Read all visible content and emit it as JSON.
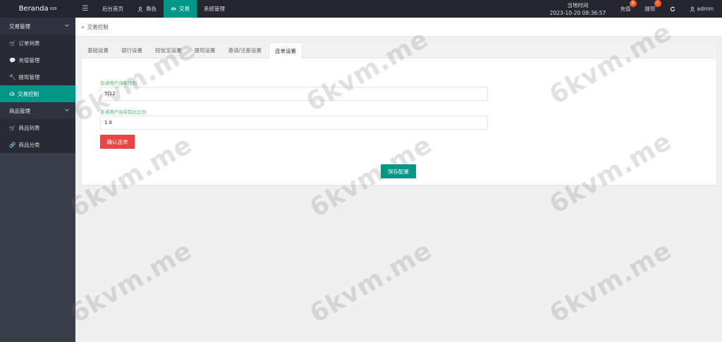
{
  "topbar": {
    "brand": "Beranda",
    "brand_version": "V20",
    "nav": [
      {
        "label": "后台首页",
        "icon": "home-icon"
      },
      {
        "label": "角色",
        "icon": "user-icon"
      },
      {
        "label": "交易",
        "icon": "scale-icon"
      },
      {
        "label": "系统管理",
        "icon": ""
      }
    ],
    "time_label": "当地时间",
    "time_value": "2023-10-20 08:36:57",
    "recharge_label": "充值",
    "recharge_count": "0",
    "withdraw_label": "提现",
    "withdraw_count": "0",
    "user_label": "admin"
  },
  "sidebar": {
    "groups": [
      {
        "label": "交易管理",
        "items": [
          "订单列表",
          "充值管理",
          "提现管理",
          "交易控制"
        ]
      },
      {
        "label": "商品管理",
        "items": [
          "商品列表",
          "商品分类"
        ]
      }
    ]
  },
  "breadcrumb": {
    "current": "交易控制"
  },
  "tabs": [
    "基础设置",
    "银行设置",
    "短信宝设置",
    "提现设置",
    "邀请/注册设置",
    "连单设置"
  ],
  "form": {
    "field1_label": "普通用户连单规则",
    "field1_value": "5|12",
    "field2_label": "普通用户连单超出比例",
    "field2_value": "1.8",
    "confirm_button": "确认连单",
    "save_button": "保存配置"
  },
  "watermark": "6kvm.me",
  "colors": {
    "accent": "#009688",
    "danger": "#e84545",
    "sidebar": "#393d49",
    "topbar": "#23262e"
  }
}
